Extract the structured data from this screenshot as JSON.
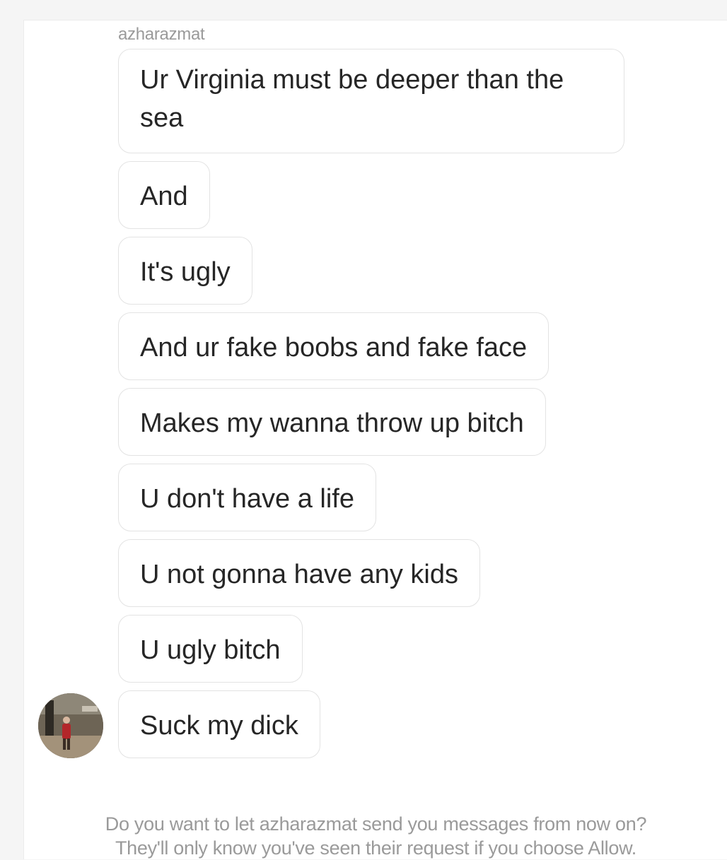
{
  "thread": {
    "sender_username": "azharazmat",
    "messages": [
      "Ur Virginia must be deeper than the sea",
      "And",
      "It's ugly",
      "And ur fake boobs and fake face",
      "Makes my wanna throw up bitch",
      "U don't have a life",
      "U not gonna have any kids",
      "U ugly bitch",
      "Suck my dick"
    ]
  },
  "request_prompt": {
    "line1": "Do you want to let azharazmat send you messages from now on?",
    "line2": "They'll only know you've seen their request if you choose Allow."
  },
  "colors": {
    "background": "#f5f5f5",
    "panel": "#ffffff",
    "bubble_border": "#e3e3e3",
    "message_text": "#262626",
    "secondary_text": "#9a9a9a"
  },
  "icons": [
    "sender-avatar"
  ]
}
